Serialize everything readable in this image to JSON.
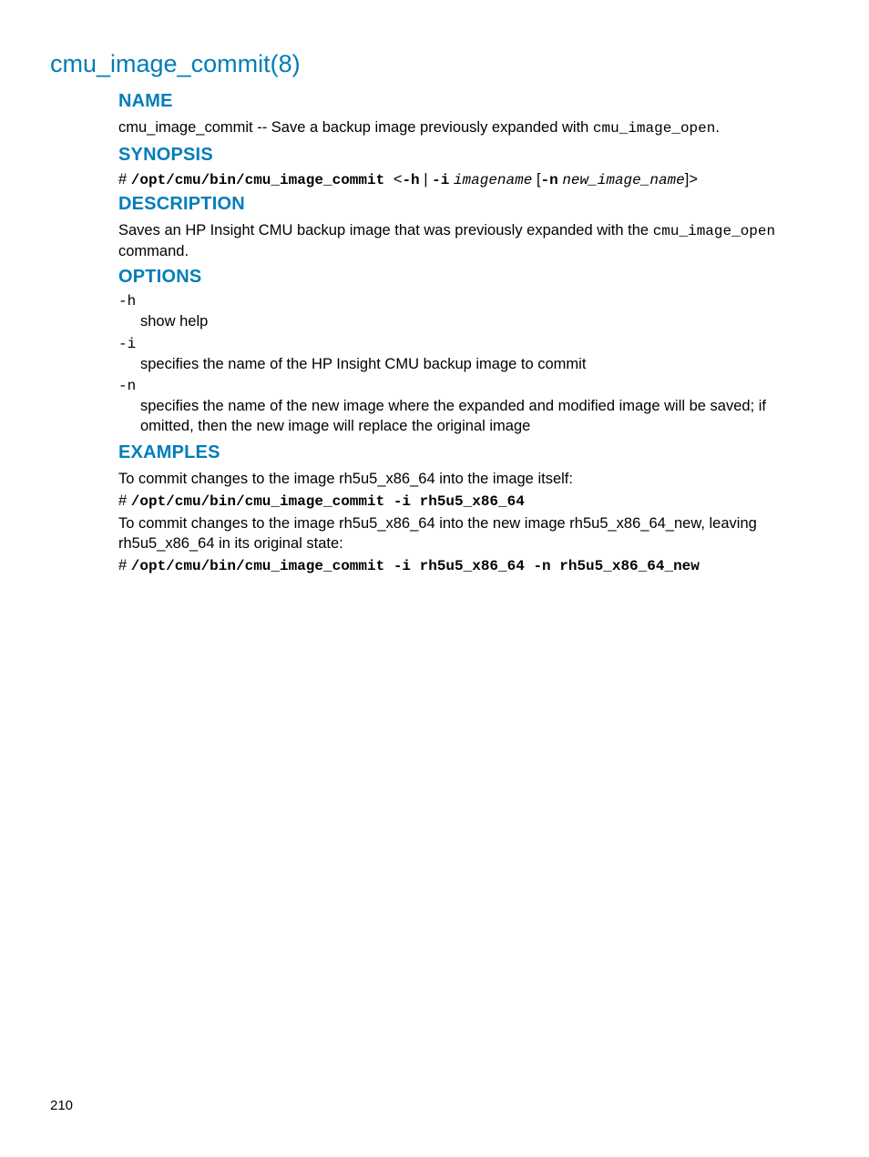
{
  "page": {
    "title": "cmu_image_commit(8)",
    "pageNumber": "210"
  },
  "sections": {
    "name": {
      "heading": "NAME",
      "text_pre": "cmu_image_commit -- Save a backup image previously expanded with ",
      "text_code": "cmu_image_open",
      "text_post": "."
    },
    "synopsis": {
      "heading": "SYNOPSIS",
      "hash": "# ",
      "cmd": "/opt/cmu/bin/cmu_image_commit ",
      "lt": " <",
      "flag_h": "-h",
      "pipe": " | ",
      "flag_i": "-i",
      "space1": " ",
      "arg_imagename": "imagename",
      "space2": " ",
      "lbracket": "[",
      "flag_n": "-n",
      "space3": " ",
      "arg_newname": "new_image_name",
      "rbracket_gt": "]>"
    },
    "description": {
      "heading": "DESCRIPTION",
      "text_pre": "Saves an HP Insight CMU backup image that was previously expanded with the ",
      "text_code": "cmu_image_open",
      "text_post": " command."
    },
    "options": {
      "heading": "OPTIONS",
      "items": [
        {
          "flag": "-h",
          "desc": "show help"
        },
        {
          "flag": "-i",
          "desc": "specifies the name of the HP Insight CMU backup image to commit"
        },
        {
          "flag": "-n",
          "desc": "specifies the name of the new image where the expanded and modified image will be saved; if omitted, then the new image will replace the original image"
        }
      ]
    },
    "examples": {
      "heading": "EXAMPLES",
      "intro1": "To commit changes to the image rh5u5_x86_64 into the image itself:",
      "cmd1_hash": "# ",
      "cmd1": "/opt/cmu/bin/cmu_image_commit -i rh5u5_x86_64",
      "intro2": "To commit changes to the image rh5u5_x86_64 into the new image rh5u5_x86_64_new, leaving rh5u5_x86_64 in its original state:",
      "cmd2_hash": "# ",
      "cmd2": "/opt/cmu/bin/cmu_image_commit -i rh5u5_x86_64 -n rh5u5_x86_64_new"
    }
  }
}
